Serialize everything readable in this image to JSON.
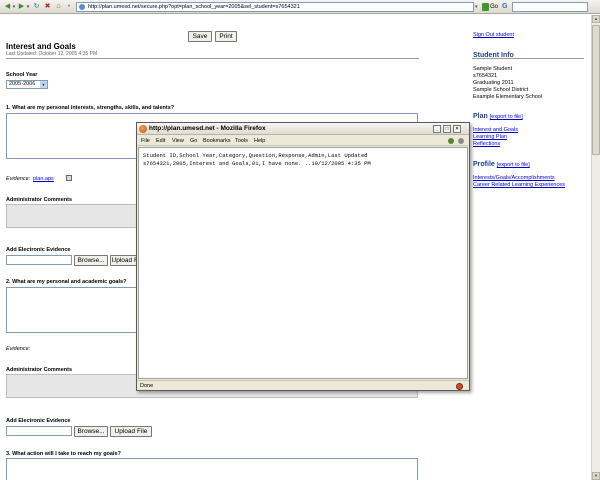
{
  "browser": {
    "url": "http://plan.umesd.net/secure.php?opt=plan_school_year=2005&sel_student=s7654321",
    "go_label": "Go",
    "search_logo": "G"
  },
  "page": {
    "save_label": "Save",
    "print_label": "Print",
    "title": "Interest and Goals",
    "last_updated": "Last Updated: October 12, 2005 4:35 PM",
    "school_year_label": "School Year",
    "school_year_value": "2005-2006",
    "q1": "1. What are my personal interests, strengths, skills, and talents?",
    "evidence_label": "Evidence:",
    "evidence_link": "plan.aps",
    "admin_comments_label": "Administrator Comments",
    "add_evidence_label": "Add Electronic Evidence",
    "browse_label": "Browse...",
    "upload_label": "Upload File",
    "q2": "2. What are my personal and academic goals?",
    "q3": "3. What action will I take to reach my goals?"
  },
  "sidebar": {
    "sign_out": "Sign Out student",
    "student_info_heading": "Student Info",
    "student_name": "Sample Student",
    "student_id": "s7654321",
    "graduating": "Graduating 2011",
    "district": "Sample School District",
    "school": "Example Elementary School",
    "plan_heading": "Plan",
    "plan_export": "[export to file]",
    "plan_links": [
      "Interest and Goals",
      "Learning Plan",
      "Reflections"
    ],
    "profile_heading": "Profile",
    "profile_export": "[export to file]",
    "profile_links": [
      "Interests/Goals/Accomplishments",
      "Career Related Learning Experiences"
    ]
  },
  "popup": {
    "title": "http://plan.umesd.net - Mozilla Firefox",
    "menu": [
      "File",
      "Edit",
      "View",
      "Go",
      "Bookmarks",
      "Tools",
      "Help"
    ],
    "content_line1": "Student ID,School Year,Category,Question,Response,Admin,Last Updated",
    "content_line2": "s7654321,2005,Interest and Goals,01,I have none. ..10/12/2005 4:35 PM",
    "status": "Done"
  }
}
